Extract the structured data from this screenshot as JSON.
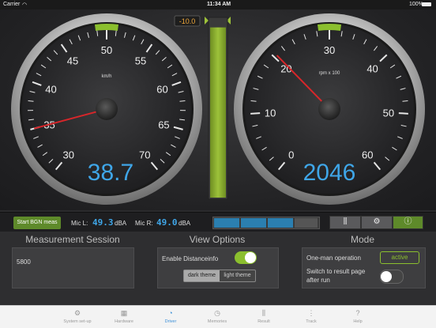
{
  "status_bar": {
    "carrier": "Carrier",
    "time": "11:34 AM",
    "battery": "100%"
  },
  "speed_gauge": {
    "unit": "km/h",
    "ticks": [
      "30",
      "35",
      "40",
      "45",
      "50",
      "55",
      "60",
      "65",
      "70"
    ],
    "readout": "38.7",
    "needle_value": 35
  },
  "level_meter": {
    "readout": "-10.0",
    "level_fraction": 0.97
  },
  "rpm_gauge": {
    "unit": "rpm x 100",
    "ticks": [
      "0",
      "10",
      "20",
      "30",
      "40",
      "50",
      "60"
    ],
    "readout": "2046",
    "needle_value": 20.5
  },
  "controls": {
    "start_bgn_label": "Start BGN meas",
    "mic_l_label": "Mic L:",
    "mic_l_value": "49.3",
    "mic_l_unit": "dBA",
    "mic_r_label": "Mic R:",
    "mic_r_value": "49.0",
    "mic_r_unit": "dBA"
  },
  "measurement_session": {
    "title": "Measurement Session",
    "value": "5800"
  },
  "view_options": {
    "title": "View Options",
    "distance_label": "Enable Distanceinfo",
    "distance_on": true,
    "theme_dark_label": "dark theme",
    "theme_light_label": "light theme",
    "selected_theme": "dark"
  },
  "mode": {
    "title": "Mode",
    "one_man_label": "One-man operation",
    "one_man_state": "active",
    "switch_label_line1": "Switch to result page",
    "switch_label_line2": "after run",
    "switch_on": false
  },
  "tabs": [
    {
      "label": "System set-up",
      "icon": "gears-icon"
    },
    {
      "label": "Hardware",
      "icon": "keyboard-icon"
    },
    {
      "label": "Driver",
      "icon": "speedometer-icon",
      "active": true
    },
    {
      "label": "Memories",
      "icon": "clock-icon"
    },
    {
      "label": "Result",
      "icon": "sliders-icon"
    },
    {
      "label": "Track",
      "icon": "track-icon"
    },
    {
      "label": "Help",
      "icon": "help-icon"
    }
  ],
  "colors": {
    "accent_green": "#5e8a2a",
    "lcd_blue": "#3fa6e8",
    "tab_active": "#3a8fd8",
    "needle_red": "#d8262a"
  }
}
